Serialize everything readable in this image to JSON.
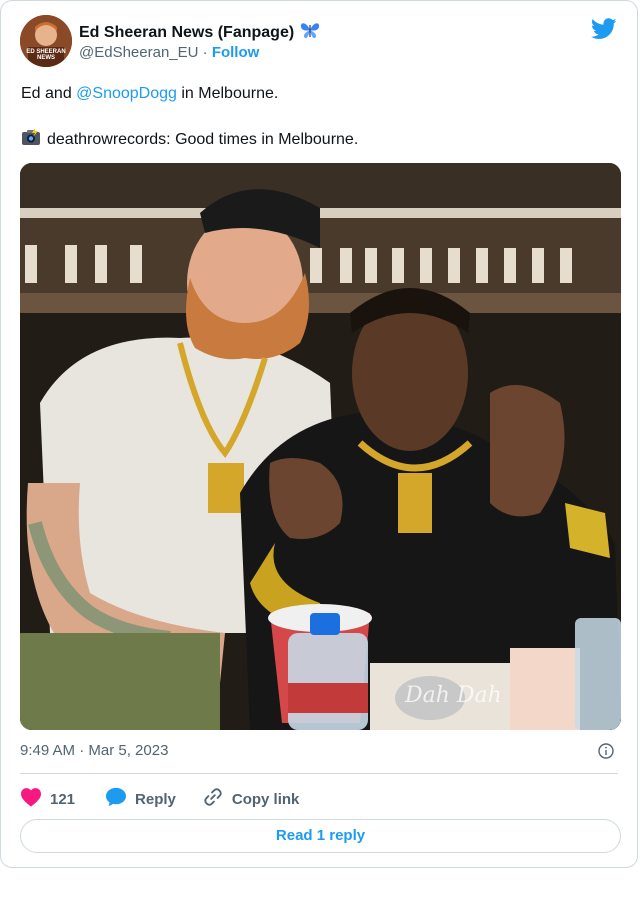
{
  "account": {
    "name": "Ed Sheeran News (Fanpage)",
    "name_emoji": "butterfly-icon",
    "handle": "@EdSheeran_EU",
    "separator": "·",
    "follow_label": "Follow",
    "avatar_text": "ED SHEERAN NEWS"
  },
  "tweet": {
    "line1_pre": "Ed and ",
    "line1_mention": "@SnoopDogg",
    "line1_post": " in Melbourne.",
    "line2_icon": "camera-flash-icon",
    "line2": "deathrowrecords: Good times in Melbourne.",
    "photo_watermark": "Dah Dah"
  },
  "meta": {
    "timestamp": "9:49 AM · Mar 5, 2023"
  },
  "actions": {
    "like_count": "121",
    "reply_label": "Reply",
    "copy_label": "Copy link",
    "read_reply_label": "Read 1 reply"
  },
  "colors": {
    "accent": "#1d9bf0",
    "like": "#f91880",
    "border": "#cfd9de",
    "muted": "#536471"
  }
}
